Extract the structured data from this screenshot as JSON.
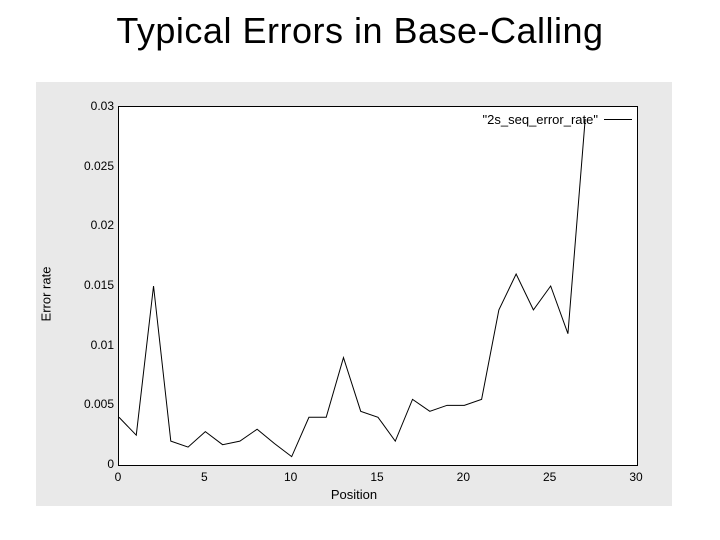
{
  "title": "Typical Errors in Base-Calling",
  "chart_data": {
    "type": "line",
    "title": "",
    "xlabel": "Position",
    "ylabel": "Error rate",
    "xlim": [
      0,
      30
    ],
    "ylim": [
      0,
      0.03
    ],
    "x_ticks": [
      0,
      5,
      10,
      15,
      20,
      25,
      30
    ],
    "y_ticks": [
      0,
      0.005,
      0.01,
      0.015,
      0.02,
      0.025,
      0.03
    ],
    "legend": {
      "label": "\"2s_seq_error_rate\"",
      "position": "top-right"
    },
    "series": [
      {
        "name": "2s_seq_error_rate",
        "x": [
          0,
          1,
          2,
          3,
          4,
          5,
          6,
          7,
          8,
          9,
          10,
          11,
          12,
          13,
          14,
          15,
          16,
          17,
          18,
          19,
          20,
          21,
          22,
          23,
          24,
          25,
          26,
          27
        ],
        "values": [
          0.004,
          0.0025,
          0.015,
          0.002,
          0.0015,
          0.0028,
          0.0017,
          0.002,
          0.003,
          0.0018,
          0.0007,
          0.004,
          0.004,
          0.009,
          0.0045,
          0.004,
          0.002,
          0.0055,
          0.0045,
          0.005,
          0.005,
          0.0055,
          0.013,
          0.016,
          0.013,
          0.015,
          0.011,
          0.029
        ]
      }
    ]
  }
}
